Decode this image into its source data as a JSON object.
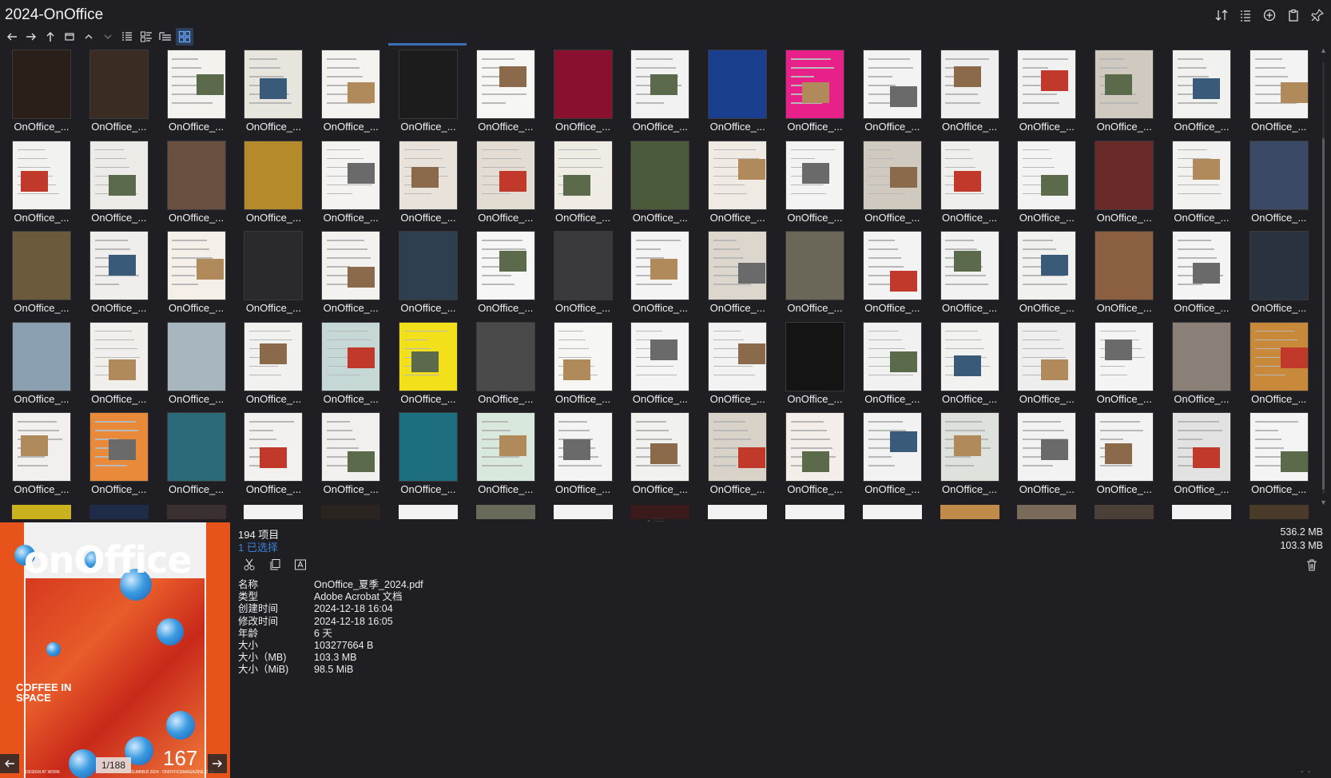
{
  "window": {
    "title": "2024-OnOffice"
  },
  "toolbar": {
    "nav": [
      "back",
      "forward",
      "up"
    ],
    "view_modes": [
      "list-view",
      "detail-view",
      "tree-view",
      "thumbnail-view"
    ],
    "active_view": "thumbnail-view"
  },
  "top_right_tools": [
    "sort-icon",
    "list-options-icon",
    "add-icon",
    "clipboard-icon",
    "pin-icon"
  ],
  "thumbnails": {
    "label": "OnOffice_...",
    "total_rows_visible": 5,
    "columns": 17,
    "colors": [
      [
        "#2b1f1a",
        "#3a2c22",
        "#f4f2ee",
        "#e8e4de",
        "#f5f3ef",
        "#1c1c1c",
        "#f6f6f4",
        "#8a1030",
        "#f2f2f2",
        "#1b3f8f",
        "#e8208a",
        "#f3f3f3",
        "#efefef",
        "#f1f1f1",
        "#cfc9bf",
        "#f1f1ef",
        "#f3f3f3"
      ],
      [
        "#f2f2f0",
        "#ecebe8",
        "#6a5040",
        "#b48a2a",
        "#f4f3f1",
        "#e8e2da",
        "#e3dcd3",
        "#efece6",
        "#4a5a3a",
        "#efeae4",
        "#f3f3f3",
        "#cfc9c0",
        "#efefed",
        "#f3f3f3",
        "#6a2a2a",
        "#f2f2f0",
        "#3a4a66"
      ],
      [
        "#6b5a3c",
        "#efeeec",
        "#f4efe8",
        "#2a2a2e",
        "#f3f2ef",
        "#2e4050",
        "#f6f6f6",
        "#3a3a3e",
        "#f4f4f4",
        "#dcd6cc",
        "#6a6658",
        "#f3f3f3",
        "#f2f2f2",
        "#f1f1ef",
        "#8a6040",
        "#f4f4f4",
        "#2a3240"
      ],
      [
        "#8aa0b0",
        "#f0efec",
        "#a8b6c0",
        "#f1f1ef",
        "#c5d8d5",
        "#f2e01a",
        "#4a4a4a",
        "#f6f6f4",
        "#f4f4f4",
        "#f2f2f2",
        "#141414",
        "#f1f1f1",
        "#f2f2f0",
        "#eeeeee",
        "#f4f4f4",
        "#8a8078",
        "#c88a3a"
      ],
      [
        "#f1f0ee",
        "#e98a3a",
        "#2c6a7a",
        "#f2f1ef",
        "#f1f0ee",
        "#1d6f80",
        "#d8e8dc",
        "#f4f4f4",
        "#f1f1ef",
        "#d8d2c8",
        "#f3eeea",
        "#f2f2f2",
        "#dde2dc",
        "#f2f2f2",
        "#f2f2f2",
        "#e2e2e2",
        "#f4f4f4"
      ]
    ],
    "partial_row_colors": [
      "#c9b21e",
      "#1e2c4a",
      "#3a3030",
      "#f2f2f2",
      "#2a2420",
      "#f2f2f2",
      "#6a6a5a",
      "#f2f2f2",
      "#3a1a1a",
      "#f2f2f2",
      "#f2f2f2",
      "#f2f2f2",
      "#c08a4a",
      "#7a6a5a",
      "#4a4038",
      "#f2f2f2",
      "#4a3a2a"
    ]
  },
  "preview": {
    "logo": "onOffice",
    "headline": "COFFEE IN SPACE",
    "issue": "167",
    "page_counter": "1/188",
    "footer_left": "DESIGN AT WORK",
    "footer_right": "SUMMER 2024 · ONOFFICEMAGAZINE.COM"
  },
  "details": {
    "item_count": "194 项目",
    "selected": "1 已选择",
    "total_size": "536.2 MB",
    "selected_size": "103.3 MB",
    "properties": [
      {
        "key": "名称",
        "value": "OnOffice_夏季_2024.pdf"
      },
      {
        "key": "类型",
        "value": "Adobe Acrobat 文档"
      },
      {
        "key": "创建时间",
        "value": "2024-12-18  16:04"
      },
      {
        "key": "修改时间",
        "value": "2024-12-18  16:05"
      },
      {
        "key": "年龄",
        "value": "6 天"
      },
      {
        "key": "大小",
        "value": "103277664 B"
      },
      {
        "key": "大小（MB)",
        "value": "103.3 MB"
      },
      {
        "key": "大小（MiB)",
        "value": "98.5 MiB"
      }
    ]
  }
}
